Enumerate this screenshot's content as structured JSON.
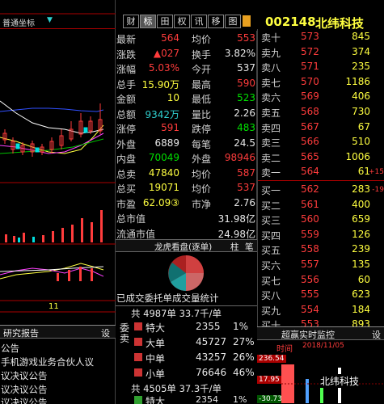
{
  "left_panel": {
    "dropdown_label": "普通坐标",
    "bottom_tab": "研究报告",
    "bottom_tab_right": "设",
    "date_axis_label": "11",
    "news": [
      "公告",
      "手机游戏业务合伙人议",
      "议决议公告",
      "议决议公告",
      "议决议公告",
      "第的建立意见"
    ]
  },
  "tabs": [
    "财",
    "标",
    "田",
    "权",
    "讯",
    "移",
    "图"
  ],
  "stock": {
    "code": "002148",
    "name": "北纬科技"
  },
  "quote_rows": [
    {
      "l1": "最新",
      "v1": "564",
      "l2": "均价",
      "v2": "553",
      "c1": "red",
      "c2": "red"
    },
    {
      "l1": "涨跌",
      "v1": "▲027",
      "l2": "换手",
      "v2": "3.82%",
      "c1": "red",
      "c2": "white"
    },
    {
      "l1": "涨幅",
      "v1": "5.03%",
      "l2": "今开",
      "v2": "537",
      "c1": "red",
      "c2": "white"
    },
    {
      "l1": "总手",
      "v1": "15.90万",
      "l2": "最高",
      "v2": "590",
      "c1": "yellow",
      "c2": "red"
    },
    {
      "l1": "金额",
      "v1": "10",
      "l2": "最低",
      "v2": "523",
      "c1": "yellow",
      "c2": "green"
    },
    {
      "l1": "总额",
      "v1": "9342万",
      "l2": "量比",
      "v2": "2.26",
      "c1": "cyan",
      "c2": "white"
    },
    {
      "l1": "涨停",
      "v1": "591",
      "l2": "跌停",
      "v2": "483",
      "c1": "red",
      "c2": "green"
    },
    {
      "l1": "外盘",
      "v1": "6889",
      "l2": "每笔",
      "v2": "24.5",
      "c1": "white",
      "c2": "white"
    },
    {
      "l1": "内盘",
      "v1": "70049",
      "l2": "外盘",
      "v2": "98946",
      "c1": "green",
      "c2": "red"
    },
    {
      "l1": "总卖",
      "v1": "47840",
      "l2": "均价",
      "v2": "587",
      "c1": "yellow",
      "c2": "red"
    },
    {
      "l1": "总买",
      "v1": "19071",
      "l2": "均价",
      "v2": "537",
      "c1": "yellow",
      "c2": "red"
    },
    {
      "l1": "市盈",
      "v1": "62.09③",
      "l2": "市净",
      "v2": "2.76",
      "c1": "yellow",
      "c2": "white"
    },
    {
      "l1": "总市值",
      "v1": "",
      "l2": "",
      "v2": "31.98亿",
      "c1": "white",
      "c2": "white"
    },
    {
      "l1": "流通市值",
      "v1": "",
      "l2": "",
      "v2": "24.98亿",
      "c1": "white",
      "c2": "white"
    }
  ],
  "ask": [
    {
      "label": "卖十",
      "price": "573",
      "vol": "845"
    },
    {
      "label": "卖九",
      "price": "572",
      "vol": "374"
    },
    {
      "label": "卖八",
      "price": "571",
      "vol": "235"
    },
    {
      "label": "卖七",
      "price": "570",
      "vol": "1186"
    },
    {
      "label": "卖六",
      "price": "569",
      "vol": "406"
    },
    {
      "label": "卖五",
      "price": "568",
      "vol": "730"
    },
    {
      "label": "卖四",
      "price": "567",
      "vol": "67"
    },
    {
      "label": "卖三",
      "price": "566",
      "vol": "510"
    },
    {
      "label": "卖二",
      "price": "565",
      "vol": "1006"
    },
    {
      "label": "卖一",
      "price": "564",
      "vol": "61",
      "chg": "+15"
    }
  ],
  "bid": [
    {
      "label": "买一",
      "price": "562",
      "vol": "283",
      "chg": "-19"
    },
    {
      "label": "买二",
      "price": "561",
      "vol": "400"
    },
    {
      "label": "买三",
      "price": "560",
      "vol": "659"
    },
    {
      "label": "买四",
      "price": "559",
      "vol": "126"
    },
    {
      "label": "买五",
      "price": "558",
      "vol": "239"
    },
    {
      "label": "买六",
      "price": "557",
      "vol": "135"
    },
    {
      "label": "买七",
      "price": "556",
      "vol": "60"
    },
    {
      "label": "买八",
      "price": "555",
      "vol": "623"
    },
    {
      "label": "买九",
      "price": "554",
      "vol": "184"
    },
    {
      "label": "买十",
      "price": "553",
      "vol": "893"
    }
  ],
  "pie": {
    "header": "龙虎看盘(逐单)",
    "btn1": "柱",
    "btn2": "笔",
    "caption": "已成交委托单成交量统计"
  },
  "flow": {
    "side_label_sell": "委卖",
    "sell_header": "共 4987单 33.7千/单",
    "buy_header": "共 4505单 37.3千/单",
    "rows": [
      {
        "name": "特大",
        "vol": "2355",
        "pct": "1%",
        "color": "#cc3333"
      },
      {
        "name": "大单",
        "vol": "45727",
        "pct": "27%",
        "color": "#cc3333"
      },
      {
        "name": "中单",
        "vol": "43257",
        "pct": "26%",
        "color": "#cc3333"
      },
      {
        "name": "小单",
        "vol": "76646",
        "pct": "46%",
        "color": "#cc3333"
      }
    ],
    "buy_first": {
      "name": "特大",
      "vol": "2354",
      "pct": "1%"
    }
  },
  "realtime": {
    "title": "超赢实时监控",
    "right_btn": "设",
    "time_label": "时间",
    "date": "2018/11/05",
    "price_hi": "236.54",
    "price_mid": "17.95",
    "price_lo": "-30.73",
    "name_tag": "北纬科技"
  }
}
